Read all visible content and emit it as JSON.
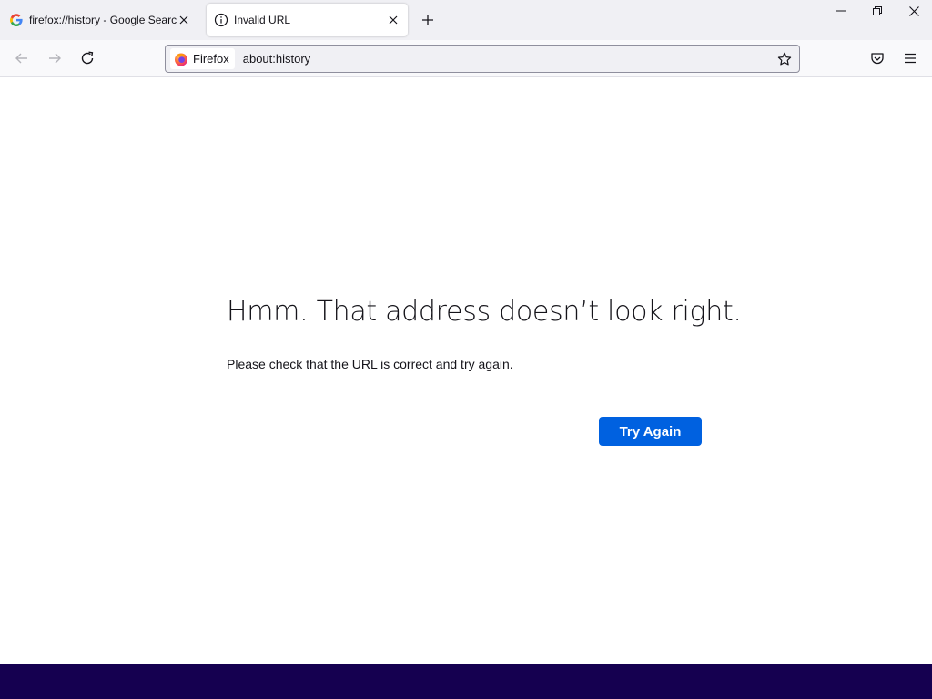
{
  "window": {
    "controls": {
      "minimize": "minimize-icon",
      "restore": "restore-icon",
      "close": "close-icon"
    }
  },
  "tabs": [
    {
      "title": "firefox://history - Google Search",
      "icon": "google-g-icon",
      "active": false
    },
    {
      "title": "Invalid URL",
      "icon": "info-icon",
      "active": true
    }
  ],
  "toolbar": {
    "back_icon": "arrow-left-icon",
    "forward_icon": "arrow-right-icon",
    "reload_icon": "reload-icon",
    "pocket_icon": "pocket-icon",
    "menu_icon": "hamburger-menu-icon"
  },
  "urlbar": {
    "identity_label": "Firefox",
    "url": "about:history",
    "bookmark_icon": "star-icon"
  },
  "error_page": {
    "title": "Hmm. That address doesn’t look right.",
    "description": "Please check that the URL is correct and try again.",
    "button_label": "Try Again"
  },
  "colors": {
    "accent": "#0061e0",
    "taskbar": "#150050",
    "tabbar_bg": "#f0f0f4",
    "text": "#15141a"
  }
}
